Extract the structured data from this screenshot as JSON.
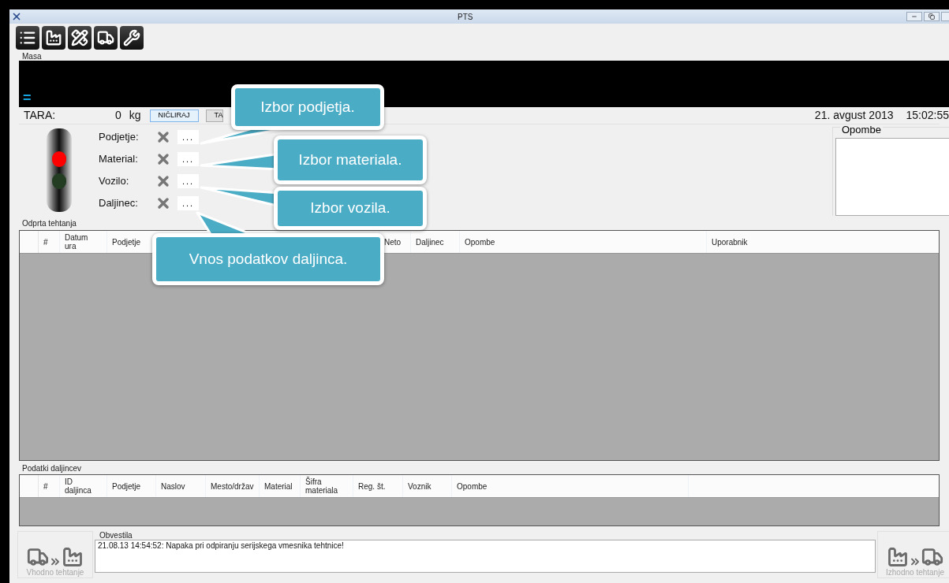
{
  "window": {
    "title": "PTS"
  },
  "toolbar": [
    {
      "kind": "list"
    },
    {
      "kind": "factory"
    },
    {
      "kind": "measure"
    },
    {
      "kind": "truck"
    },
    {
      "kind": "tools"
    }
  ],
  "mass": {
    "label": "Masa",
    "reading": "="
  },
  "tara": {
    "label": "TARA:",
    "value": "0",
    "unit": "kg",
    "buttons": [
      "NIČLIRAJ",
      "TA"
    ],
    "date": "21. avgust 2013",
    "time": "15:02:55"
  },
  "traffic_light": {
    "red_on": true,
    "green_on": false
  },
  "fields": [
    {
      "label": "Podjetje:",
      "value": "..."
    },
    {
      "label": "Material:",
      "value": "..."
    },
    {
      "label": "Vozilo:",
      "value": "..."
    },
    {
      "label": "Daljinec:",
      "value": "..."
    }
  ],
  "notes": {
    "label": "Opombe"
  },
  "open_weighings": {
    "title": "Odprta tehtanja",
    "columns": [
      "#",
      "Datum ura",
      "Podjetje",
      "Neto",
      "Daljinec",
      "Opombe",
      "Uporabnik"
    ]
  },
  "remote_data": {
    "title": "Podatki daljincev",
    "columns": [
      "#",
      "ID daljinca",
      "Podjetje",
      "Naslov",
      "Mesto/držav",
      "Material",
      "Šifra materiala",
      "Reg. št.",
      "Voznik",
      "Opombe"
    ]
  },
  "messages": {
    "title": "Obvestila",
    "lines": [
      "21.08.13 14:54:52: Napaka pri odpiranju serijskega vmesnika tehtnice!"
    ]
  },
  "bottom_buttons": [
    {
      "kind": "in",
      "label": "Vhodno tehtanje",
      "disabled": true
    },
    {
      "kind": "out",
      "label": "Izhodno tehtanje",
      "disabled": true
    }
  ],
  "callouts": [
    {
      "text": "Izbor podjetja."
    },
    {
      "text": "Izbor materiala."
    },
    {
      "text": "Izbor vozila."
    },
    {
      "text": "Vnos podatkov daljinca."
    }
  ]
}
